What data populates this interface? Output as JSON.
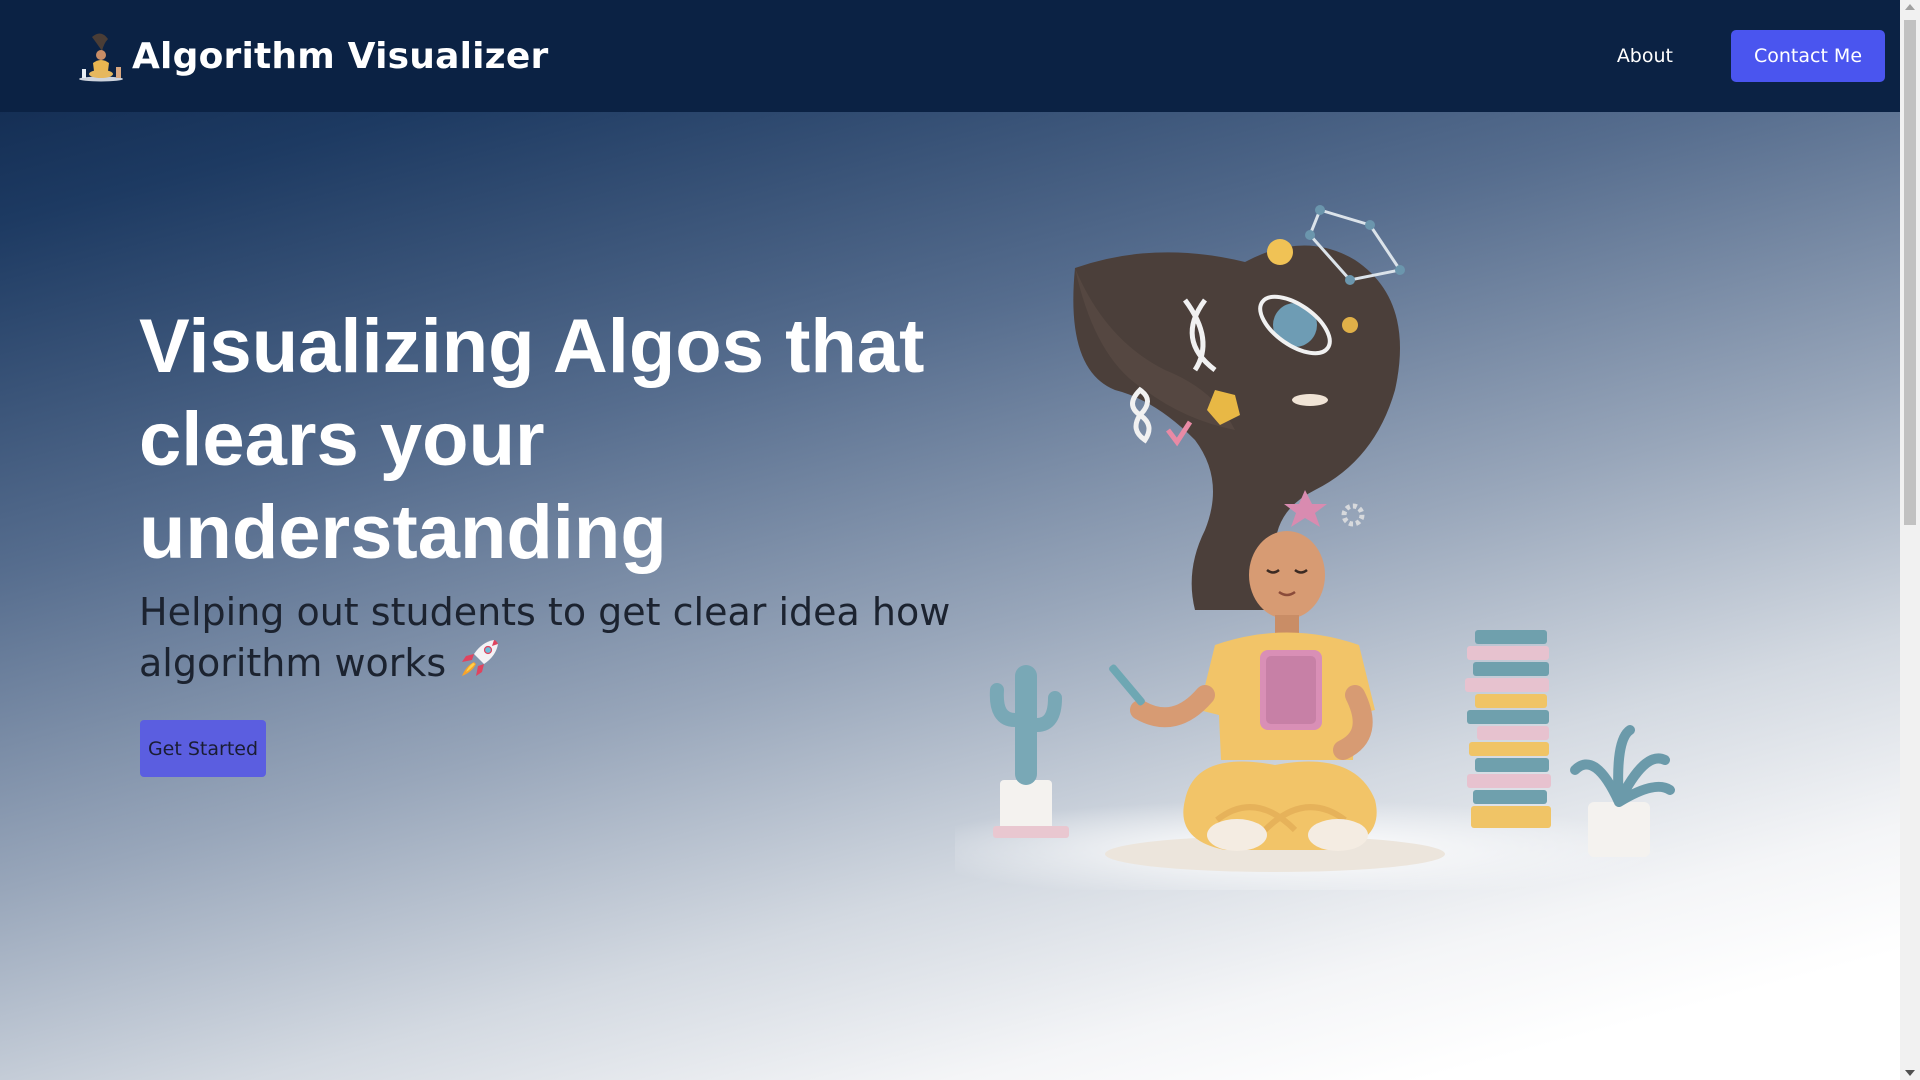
{
  "navbar": {
    "brand": "Algorithm Visualizer",
    "logo_icon": "meditating-figure-logo-icon",
    "about_label": "About",
    "contact_label": "Contact Me"
  },
  "hero": {
    "title": "Visualizing Algos that clears your understanding",
    "subtitle": "Helping out students to get clear idea how algorithm works",
    "subtitle_icon": "rocket-icon",
    "cta_label": "Get Started",
    "illustration": "person-meditating-with-tablet-illustration"
  },
  "colors": {
    "navbar_bg": "#0b2244",
    "accent": "#4a55ef",
    "cta_bg": "#5b5ee0",
    "title_text": "#ffffff"
  }
}
